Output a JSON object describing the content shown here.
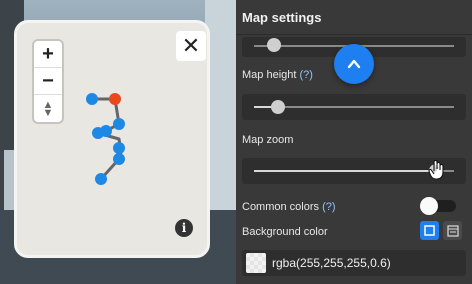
{
  "map": {
    "zoom_in_label": "+",
    "zoom_out_label": "−",
    "close_label": "✕",
    "info_label": "i",
    "route_color": "#666666",
    "point_color": "#1e88e5",
    "start_point_color": "#e8491d"
  },
  "panel": {
    "title": "Map settings",
    "map_height_label": "Map height",
    "map_height_hint": "(?)",
    "map_height_value": 0.11,
    "top_slider_value": 0.07,
    "map_zoom_label": "Map zoom",
    "map_zoom_value": 0.88,
    "common_colors_label": "Common colors",
    "common_colors_hint": "(?)",
    "common_colors_on": false,
    "background_color_label": "Background color",
    "background_color_value": "rgba(255,255,255,0.6)",
    "accent_color": "#1e7ff0"
  }
}
